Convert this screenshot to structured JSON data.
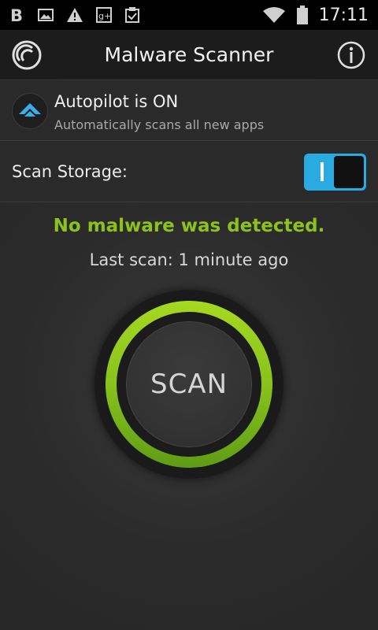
{
  "status_bar": {
    "time": "17:11",
    "left_icons": [
      "b-app-icon",
      "image-icon",
      "warning-icon",
      "google-plus-icon",
      "clipboard-check-icon"
    ],
    "right_icons": [
      "wifi-icon",
      "battery-icon"
    ]
  },
  "action_bar": {
    "title": "Malware Scanner"
  },
  "autopilot": {
    "title": "Autopilot is ON",
    "subtitle": "Automatically scans all new apps"
  },
  "scan_storage": {
    "label": "Scan Storage:",
    "enabled": true
  },
  "result": {
    "message": "No malware was detected.",
    "last_scan": "Last scan: 1 minute ago"
  },
  "scan_button": {
    "label": "SCAN"
  },
  "colors": {
    "accent_green": "#8cc21a",
    "toggle_blue": "#29abe2",
    "autopilot_icon_blue": "#3aaee8"
  }
}
